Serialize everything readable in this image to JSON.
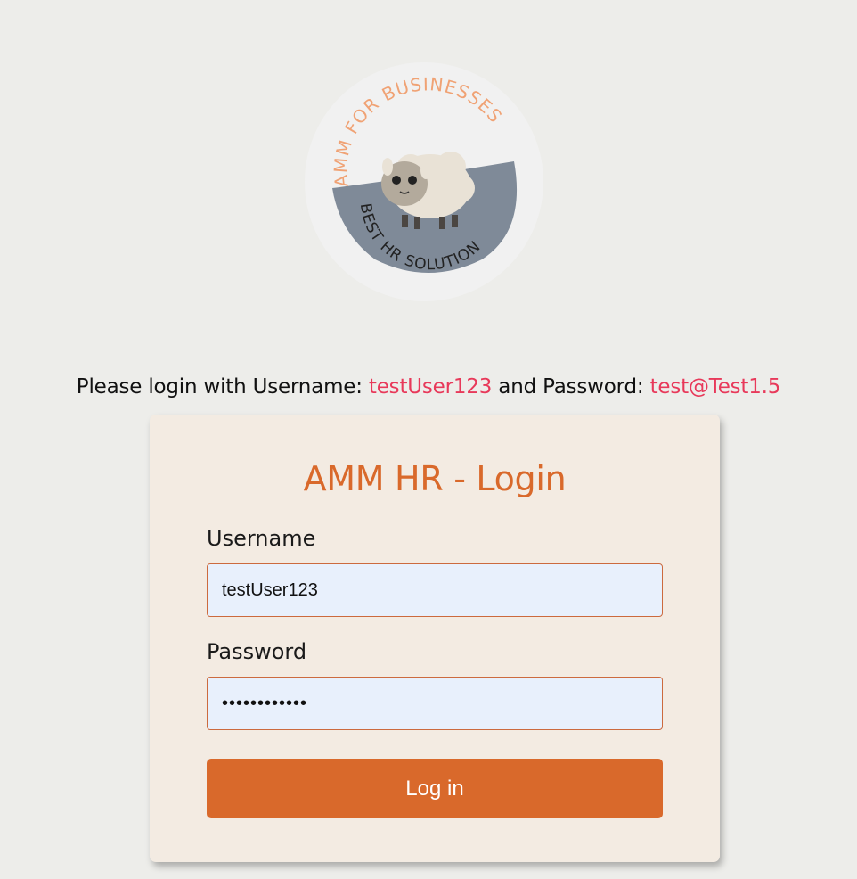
{
  "logo": {
    "top_text": "AMM FOR BUSINESSES",
    "bottom_text": "BEST HR SOLUTION",
    "icon": "sheep-icon",
    "colors": {
      "circle": "#f1f1f1",
      "band": "#7f8a98",
      "text_top": "#f0a274",
      "text_bottom": "#222222"
    }
  },
  "hint": {
    "prefix": "Please login with Username: ",
    "username": "testUser123",
    "middle": " and Password: ",
    "password": "test@Test1.5"
  },
  "login_form": {
    "title": "AMM HR - Login",
    "username_label": "Username",
    "username_value": "testUser123",
    "password_label": "Password",
    "password_value": "test@Test1.5",
    "submit_label": "Log in"
  },
  "colors": {
    "accent": "#d9692b",
    "credential_highlight": "#e8395a",
    "card_background": "#f3ebe2",
    "input_background": "#e8f0fc",
    "page_background": "#ededea"
  }
}
